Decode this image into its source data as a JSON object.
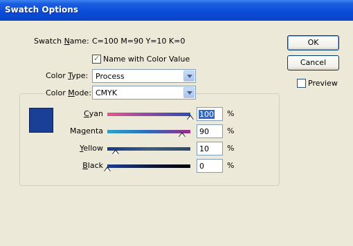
{
  "window": {
    "title": "Swatch Options"
  },
  "swatch_name": {
    "label_pre": "Swatch ",
    "label_key": "N",
    "label_post": "ame:",
    "value": "C=100 M=90 Y=10 K=0"
  },
  "name_with_color_value": {
    "label": "Name with Color Value",
    "checked": true
  },
  "color_type": {
    "label_pre": "Color ",
    "label_key": "T",
    "label_post": "ype:",
    "value": "Process"
  },
  "color_mode": {
    "label_pre": "Color ",
    "label_key": "M",
    "label_post": "ode:",
    "value": "CMYK"
  },
  "swatch_color": "#1a3f96",
  "sliders": [
    {
      "key": "C",
      "post": "yan",
      "pre": "",
      "value": "100",
      "fraction": 1.0,
      "unit": "%"
    },
    {
      "key": "g",
      "pre": "Ma",
      "post": "enta",
      "value": "90",
      "fraction": 0.9,
      "unit": "%"
    },
    {
      "key": "Y",
      "pre": "",
      "post": "ellow",
      "value": "10",
      "fraction": 0.1,
      "unit": "%"
    },
    {
      "key": "B",
      "pre": "",
      "post": "lack",
      "value": "0",
      "fraction": 0.0,
      "unit": "%"
    }
  ],
  "buttons": {
    "ok": "OK",
    "cancel": "Cancel"
  },
  "preview": {
    "label": "Preview",
    "checked": false
  }
}
